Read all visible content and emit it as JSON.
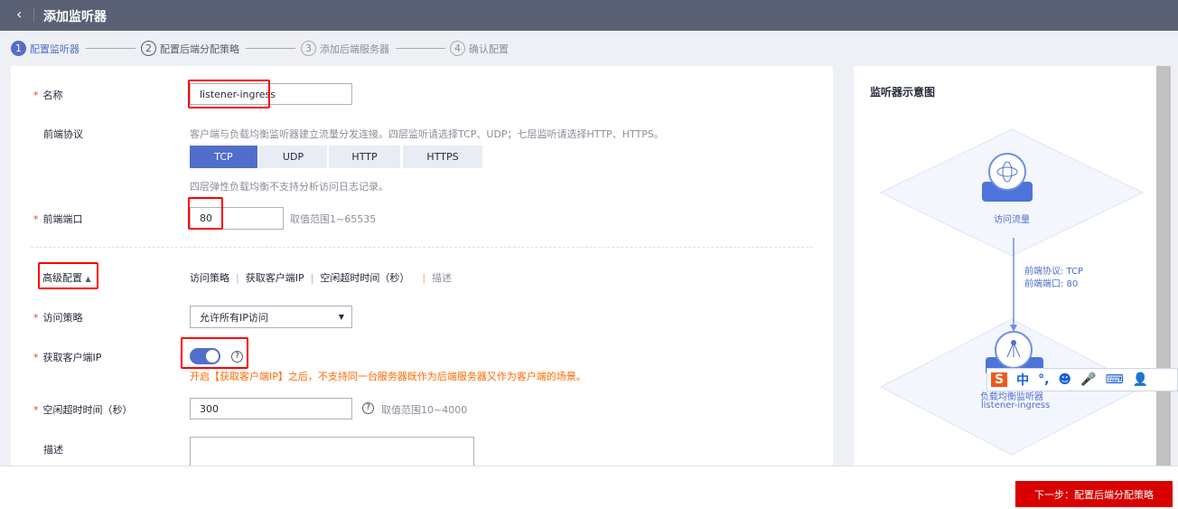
{
  "header": {
    "title": "添加监听器",
    "back_icon": "chevron-left-icon"
  },
  "steps": [
    {
      "num": "1",
      "label": "配置监听器",
      "active": true
    },
    {
      "num": "2",
      "label": "配置后端分配策略"
    },
    {
      "num": "3",
      "label": "添加后端服务器"
    },
    {
      "num": "4",
      "label": "确认配置"
    }
  ],
  "form": {
    "name": {
      "label": "名称",
      "value": "listener-ingress"
    },
    "protocol": {
      "label": "前端协议",
      "hint": "客户端与负载均衡监听器建立流量分发连接。四层监听请选择TCP、UDP；七层监听请选择HTTP、HTTPS。",
      "options": [
        "TCP",
        "UDP",
        "HTTP",
        "HTTPS"
      ],
      "selected": "TCP",
      "note": "四层弹性负载均衡不支持分析访问日志记录。"
    },
    "port": {
      "label": "前端端口",
      "value": "80",
      "range": "取值范围1~65535"
    },
    "advanced": {
      "label": "高级配置",
      "links": [
        "访问策略",
        "获取客户端IP",
        "空闲超时时间（秒）",
        "描述"
      ]
    },
    "access_policy": {
      "label": "访问策略",
      "value": "允许所有IP访问"
    },
    "client_ip": {
      "label": "获取客户端IP",
      "enabled": true,
      "warning": "开启【获取客户端IP】之后，不支持同一台服务器既作为后端服务器又作为客户端的场景。"
    },
    "idle_timeout": {
      "label": "空闲超时时间（秒）",
      "value": "300",
      "range": "取值范围10~4000"
    },
    "description": {
      "label": "描述",
      "value": ""
    }
  },
  "diagram": {
    "title": "监听器示意图",
    "top_node": "访问流量",
    "proto_label": "前端协议: TCP",
    "port_label": "前端端口: 80",
    "bottom_node": "负载均衡监听器",
    "bottom_name": "listener-ingress"
  },
  "footer": {
    "next_label": "下一步：配置后端分配策略"
  },
  "colors": {
    "header": "#5a6175",
    "primary": "#526ecc",
    "danger": "#e0453a",
    "next_button": "#d90000",
    "warning": "#ff6a00"
  }
}
